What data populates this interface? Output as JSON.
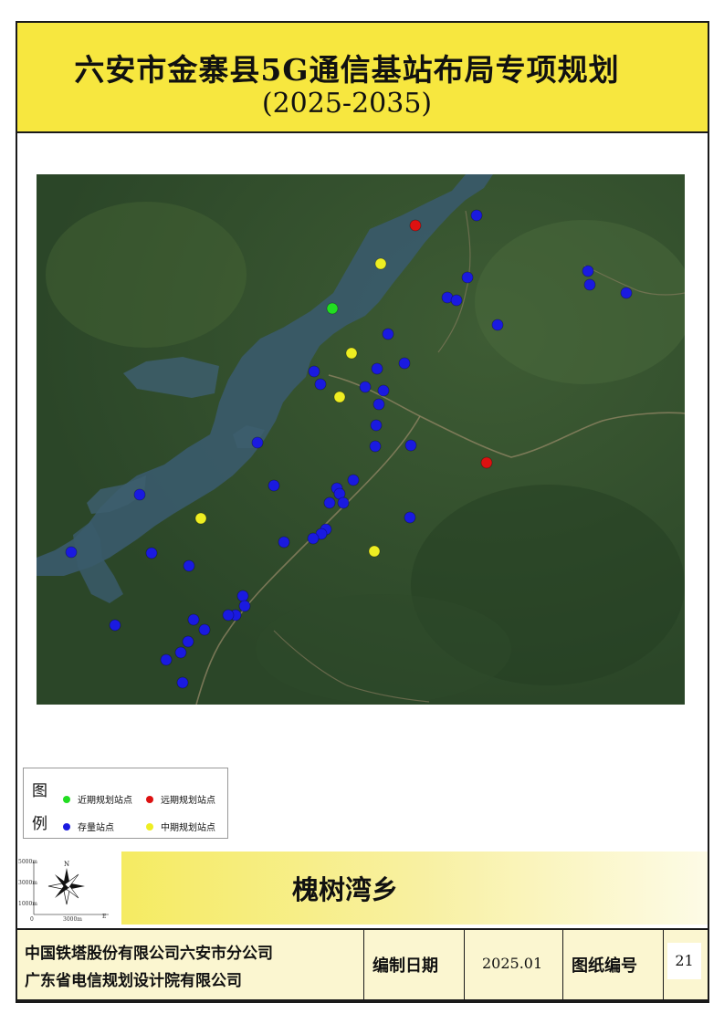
{
  "title": {
    "line1": "六安市金寨县5G通信基站布局专项规划",
    "line2": "(2025-2035)"
  },
  "legend": {
    "title_chars": [
      "图",
      "例"
    ],
    "items": [
      {
        "label": "近期规划站点",
        "color": "#22dd22"
      },
      {
        "label": "远期规划站点",
        "color": "#dd1111"
      },
      {
        "label": "存量站点",
        "color": "#1a1ae0"
      },
      {
        "label": "中期规划站点",
        "color": "#eeee22"
      }
    ]
  },
  "compass": {
    "north": "N",
    "scale_y": [
      "5000m",
      "3000m",
      "1000m",
      "0"
    ],
    "scale_x": "3000m",
    "east": "E"
  },
  "map": {
    "water_color": "#3a5a6a",
    "land_color": "#34502d",
    "sites": {
      "existing": [
        [
          522,
          236
        ],
        [
          644,
          297
        ],
        [
          646,
          312
        ],
        [
          686,
          321
        ],
        [
          512,
          304
        ],
        [
          490,
          326
        ],
        [
          500,
          329
        ],
        [
          545,
          356
        ],
        [
          425,
          366
        ],
        [
          443,
          398
        ],
        [
          413,
          404
        ],
        [
          344,
          407
        ],
        [
          351,
          421
        ],
        [
          400,
          424
        ],
        [
          420,
          428
        ],
        [
          415,
          443
        ],
        [
          412,
          466
        ],
        [
          411,
          489
        ],
        [
          450,
          488
        ],
        [
          282,
          485
        ],
        [
          387,
          526
        ],
        [
          300,
          532
        ],
        [
          369,
          535
        ],
        [
          372,
          541
        ],
        [
          361,
          551
        ],
        [
          376,
          551
        ],
        [
          153,
          542
        ],
        [
          449,
          567
        ],
        [
          357,
          580
        ],
        [
          352,
          585
        ],
        [
          343,
          590
        ],
        [
          311,
          594
        ],
        [
          78,
          605
        ],
        [
          166,
          606
        ],
        [
          207,
          620
        ],
        [
          266,
          653
        ],
        [
          268,
          664
        ],
        [
          258,
          674
        ],
        [
          250,
          674
        ],
        [
          212,
          679
        ],
        [
          224,
          690
        ],
        [
          126,
          685
        ],
        [
          206,
          703
        ],
        [
          198,
          715
        ],
        [
          182,
          723
        ],
        [
          200,
          748
        ]
      ],
      "near_term": [
        [
          364,
          338
        ]
      ],
      "mid_term": [
        [
          417,
          289
        ],
        [
          385,
          387
        ],
        [
          372,
          435
        ],
        [
          220,
          568
        ],
        [
          410,
          604
        ]
      ],
      "long_term": [
        [
          455,
          247
        ],
        [
          533,
          507
        ]
      ]
    }
  },
  "village_name": "槐树湾乡",
  "footer": {
    "company_1": "中国铁塔股份有限公司六安市分公司",
    "company_2": "广东省电信规划设计院有限公司",
    "date_label": "编制日期",
    "date_value": "2025.01",
    "sheet_label": "图纸编号",
    "sheet_value": "21"
  }
}
